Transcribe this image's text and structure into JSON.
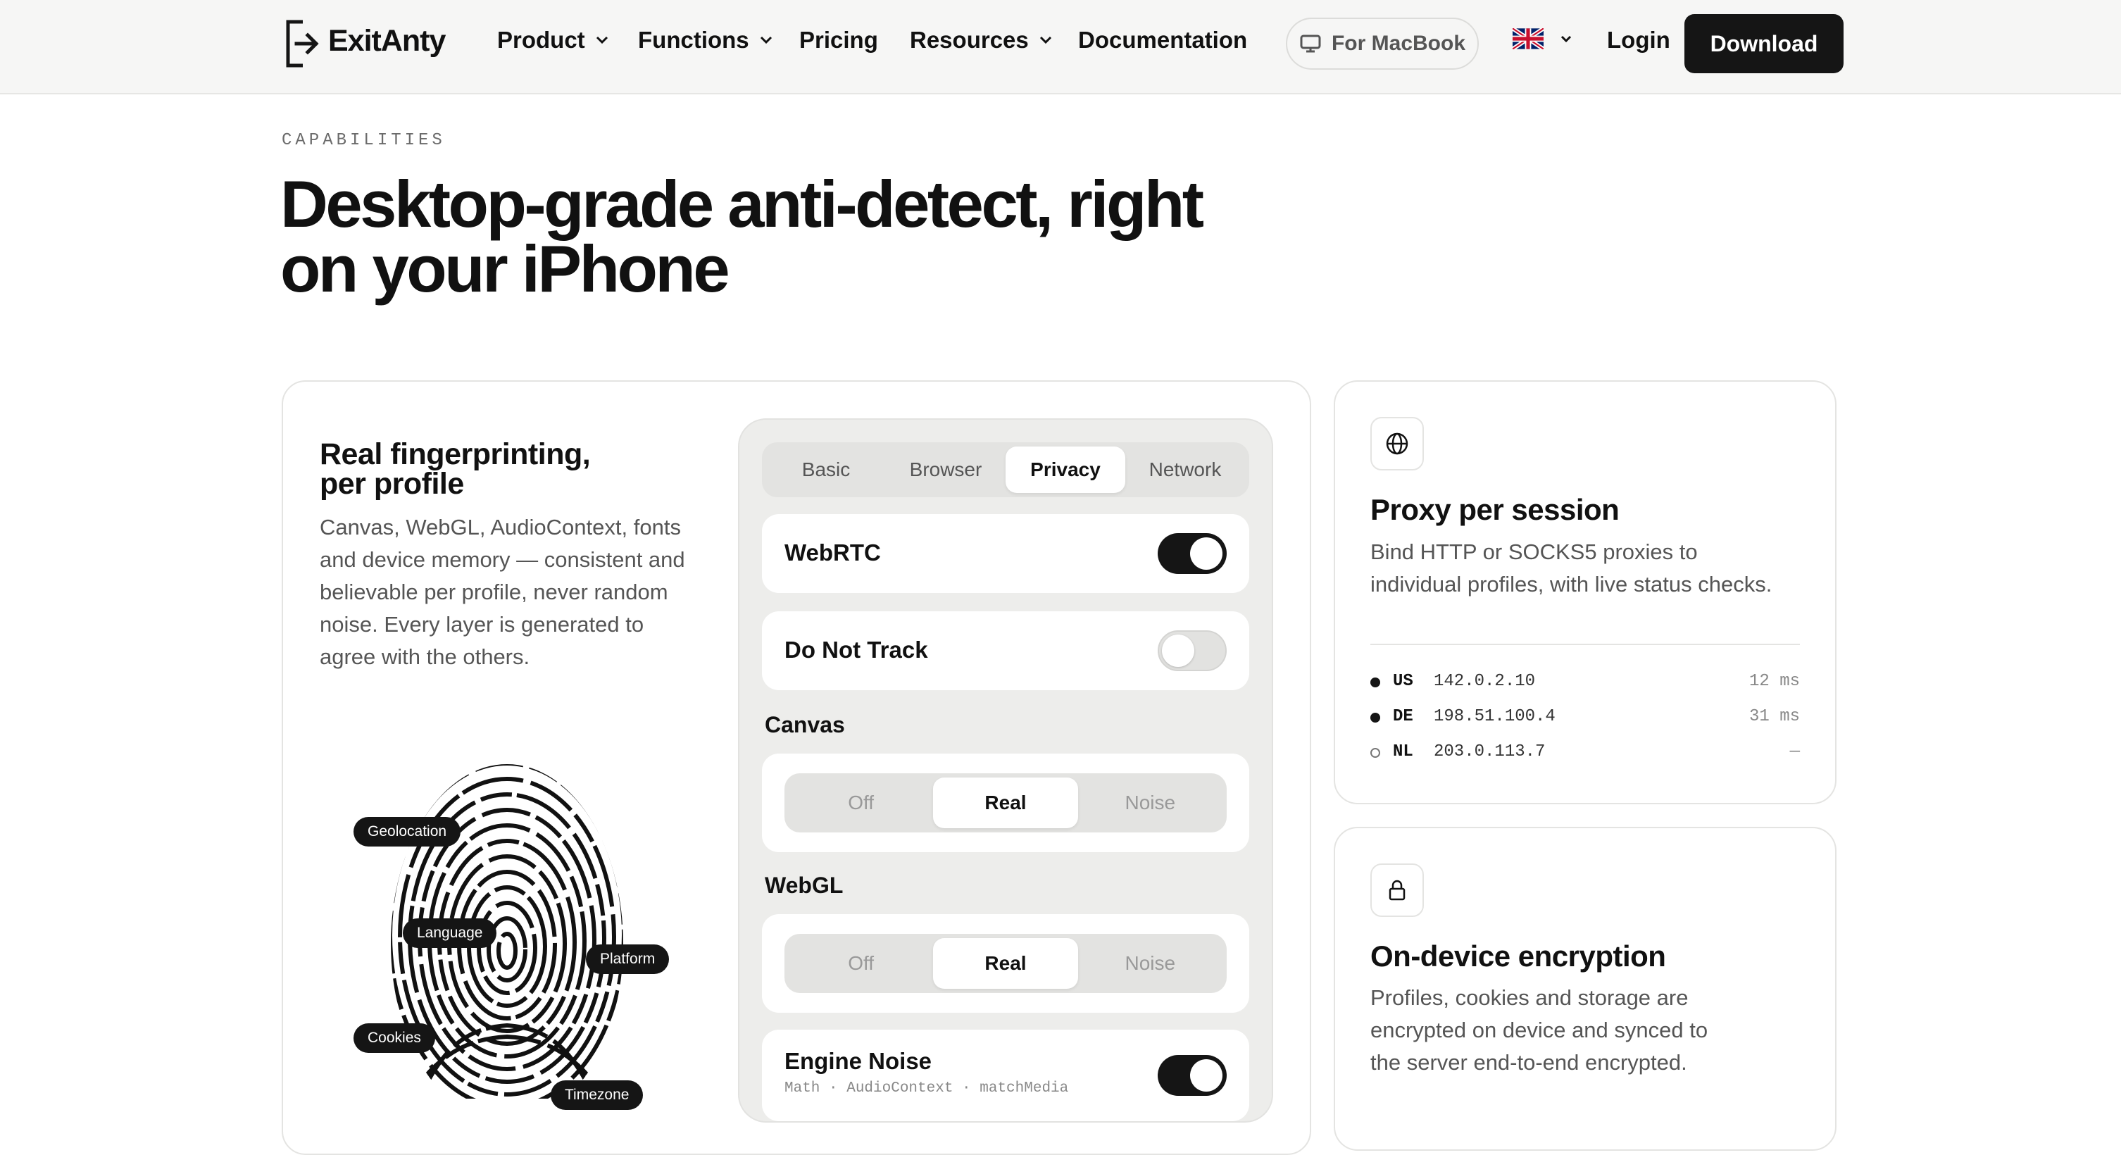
{
  "header": {
    "brand": "ExitAnty",
    "nav": [
      {
        "label": "Product",
        "has_dropdown": true
      },
      {
        "label": "Functions",
        "has_dropdown": true
      },
      {
        "label": "Pricing",
        "has_dropdown": false
      },
      {
        "label": "Resources",
        "has_dropdown": true
      },
      {
        "label": "Documentation",
        "has_dropdown": false
      }
    ],
    "platform_button": "For MacBook",
    "language_flag": "🇬🇧",
    "login": "Login",
    "download": "Download"
  },
  "hero": {
    "eyebrow": "CAPABILITIES",
    "title_line1": "Desktop-grade anti-detect, right",
    "title_line2": "on your iPhone"
  },
  "fingerprint_card": {
    "title": "Real fingerprinting, per profile",
    "description": "Canvas, WebGL, AudioContext, fonts and device memory — consistent and believable per profile, never random noise. Every layer is generated to agree with the others.",
    "tags": [
      "Geolocation",
      "Language",
      "Platform",
      "Cookies",
      "Timezone"
    ],
    "panel": {
      "tabs": [
        "Basic",
        "Browser",
        "Privacy",
        "Network"
      ],
      "active_tab": "Privacy",
      "webrtc": {
        "label": "WebRTC",
        "enabled": true
      },
      "dnt": {
        "label": "Do Not Track",
        "enabled": false
      },
      "canvas": {
        "label": "Canvas",
        "options": [
          "Off",
          "Real",
          "Noise"
        ],
        "selected": "Real"
      },
      "webgl": {
        "label": "WebGL",
        "options": [
          "Off",
          "Real",
          "Noise"
        ],
        "selected": "Real"
      },
      "engine_noise": {
        "label": "Engine Noise",
        "sub": "Math · AudioContext · matchMedia",
        "enabled": true
      }
    }
  },
  "proxy_card": {
    "icon": "globe-icon",
    "title": "Proxy per session",
    "description_line1": "Bind HTTP or SOCKS5 proxies to",
    "description_line2": "individual profiles, with live status checks.",
    "rows": [
      {
        "country": "US",
        "ip": "142.0.2.10",
        "latency": "12 ms",
        "online": true
      },
      {
        "country": "DE",
        "ip": "198.51.100.4",
        "latency": "31 ms",
        "online": true
      },
      {
        "country": "NL",
        "ip": "203.0.113.7",
        "latency": "—",
        "online": false
      }
    ]
  },
  "encryption_card": {
    "icon": "lock-icon",
    "title": "On-device encryption",
    "description_line1": "Profiles, cookies and storage are",
    "description_line2": "encrypted on device and synced to",
    "description_line3": "the server end-to-end encrypted."
  },
  "colors": {
    "accent": "#151515",
    "header_bg": "#f6f6f5",
    "panel_bg": "#ededeb",
    "muted_text": "#555555"
  }
}
